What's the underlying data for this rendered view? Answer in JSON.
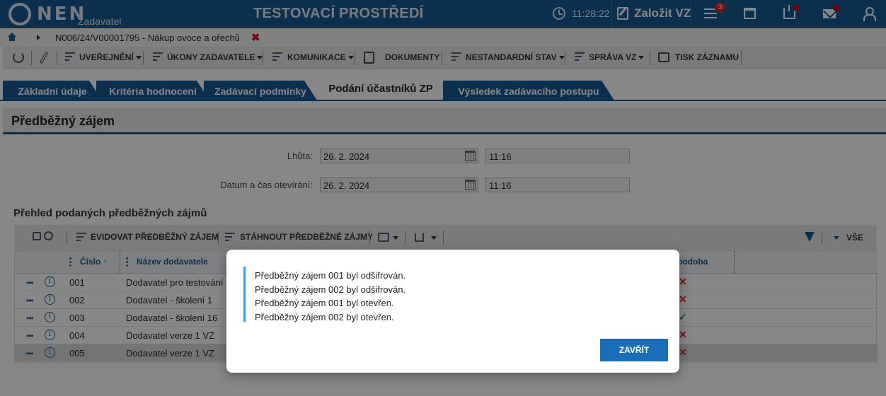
{
  "app": {
    "logo": "NEN",
    "logo_sub": "Zadavatel",
    "environment_title": "TESTOVACÍ PROSTŘEDÍ",
    "time": "11:28:22",
    "create_label": "Založit VZ",
    "notification_count": "3",
    "brand_color": "#1a5a94"
  },
  "breadcrumb": {
    "text": "N006/24/V00001795 - Nákup ovoce a ořechů",
    "close_symbol": "✖"
  },
  "toolbar": {
    "items": [
      {
        "label": "UVEŘEJNĚNÍ"
      },
      {
        "label": "ÚKONY ZADAVATELE"
      },
      {
        "label": "KOMUNIKACE"
      },
      {
        "label": "DOKUMENTY"
      },
      {
        "label": "NESTANDARDNÍ STAV"
      },
      {
        "label": "SPRÁVA VZ"
      },
      {
        "label": "TISK ZÁZNAMU"
      }
    ]
  },
  "tabs": [
    {
      "label": "Základní údaje"
    },
    {
      "label": "Kritéria hodnocení"
    },
    {
      "label": "Zadávací podmínky"
    },
    {
      "label": "Podání účastníků ZP"
    },
    {
      "label": "Výsledek zadávacího postupu"
    }
  ],
  "section": {
    "title": "Předběžný zájem",
    "deadline_label": "Lhůta:",
    "deadline_date": "26. 2. 2024",
    "deadline_time": "11:16",
    "opening_label": "Datum a čas otevírání:",
    "opening_date": "26. 2. 2024",
    "opening_time": "11:16"
  },
  "overview": {
    "title": "Přehled podaných předběžných zájmů",
    "btn_record": "EVIDOVAT PŘEDBĚŽNÝ ZÁJEM",
    "btn_download": "STÁHNOUT PŘEDBĚŽNÉ ZÁJMY",
    "filter_all": "VŠE",
    "columns": {
      "number": "Číslo",
      "supplier": "Název dodavatele",
      "form": "podoba"
    },
    "rows": [
      {
        "number": "001",
        "supplier": "Dodavatel pro testování",
        "mark": "✕"
      },
      {
        "number": "002",
        "supplier": "Dodavatel - školení 1",
        "mark": "✕"
      },
      {
        "number": "003",
        "supplier": "Dodavatel - školení 16",
        "mark": "✓"
      },
      {
        "number": "004",
        "supplier": "Dodavatel verze 1 VZ",
        "mark": "✕"
      },
      {
        "number": "005",
        "supplier": "Dodavatel verze 1 VZ",
        "mark": "✕"
      }
    ]
  },
  "modal": {
    "messages": [
      "Předběžný zájem 001 byl odšifrován.",
      "Předběžný zájem 002 byl odšifrován.",
      "Předběžný zájem 001 byl otevřen.",
      "Předběžný zájem 002 byl otevřen."
    ],
    "close_button": "ZAVŘÍT"
  }
}
